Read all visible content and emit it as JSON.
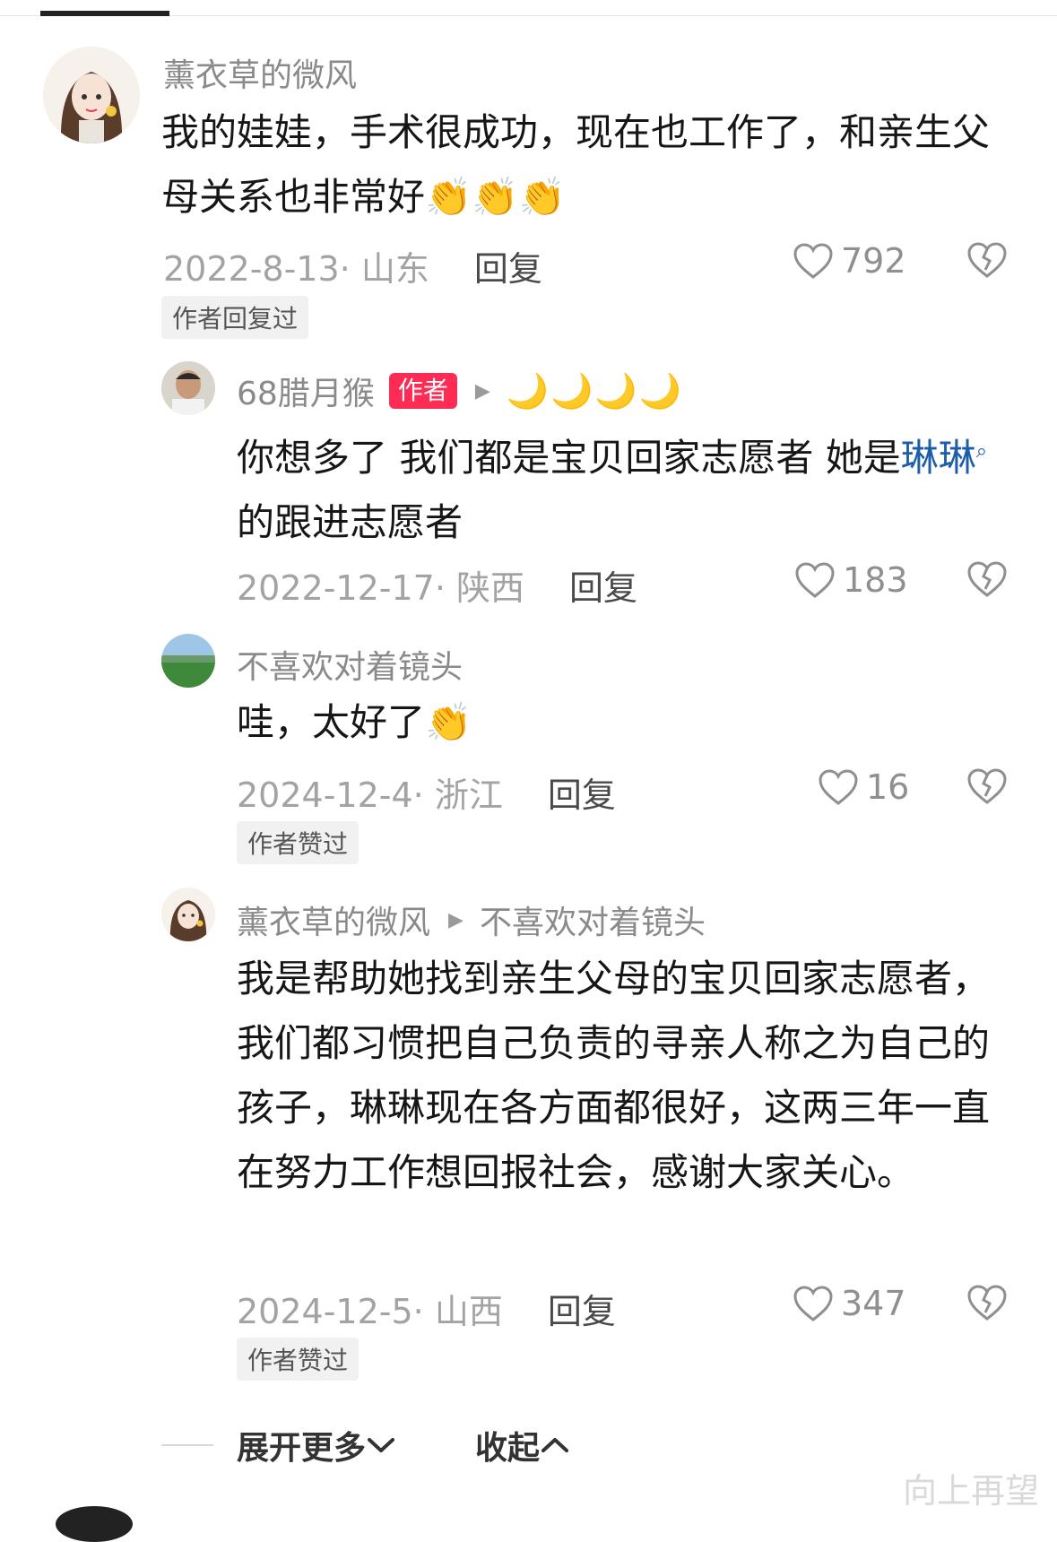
{
  "comments": [
    {
      "username": "薰衣草的微风",
      "text": "我的娃娃，手术很成功，现在也工作了，和亲生父母关系也非常好👏👏👏",
      "date": "2022-8-13· 山东",
      "reply_label": "回复",
      "likes": "792",
      "tag": "作者回复过"
    },
    {
      "username": "68腊月猴",
      "author_tag": "作者",
      "moons": "🌙🌙🌙🌙",
      "text_before": "你想多了 我们都是宝贝回家志愿者 她是",
      "link": "琳琳",
      "text_after": "的跟进志愿者",
      "date": "2022-12-17· 陕西",
      "reply_label": "回复",
      "likes": "183"
    },
    {
      "username": "不喜欢对着镜头",
      "text": "哇，太好了👏",
      "date": "2024-12-4· 浙江",
      "reply_label": "回复",
      "likes": "16",
      "tag": "作者赞过"
    },
    {
      "username": "薰衣草的微风",
      "reply_to": "不喜欢对着镜头",
      "text": "我是帮助她找到亲生父母的宝贝回家志愿者，我们都习惯把自己负责的寻亲人称之为自己的孩子，琳琳现在各方面都很好，这两三年一直在努力工作想回报社会，感谢大家关心。",
      "date": "2024-12-5· 山西",
      "reply_label": "回复",
      "likes": "347",
      "tag": "作者赞过"
    }
  ],
  "footer": {
    "expand_label": "展开更多",
    "collapse_label": "收起"
  },
  "watermark": "向上再望",
  "icons": {
    "like": "heart-outline-icon",
    "dislike": "broken-heart-icon",
    "expand": "chevron-down-icon",
    "collapse": "chevron-up-icon",
    "search": "search-icon",
    "reply_to": "triangle-right-icon"
  },
  "colors": {
    "author_tag": "#fe2c55",
    "link": "#1c5fa8"
  }
}
